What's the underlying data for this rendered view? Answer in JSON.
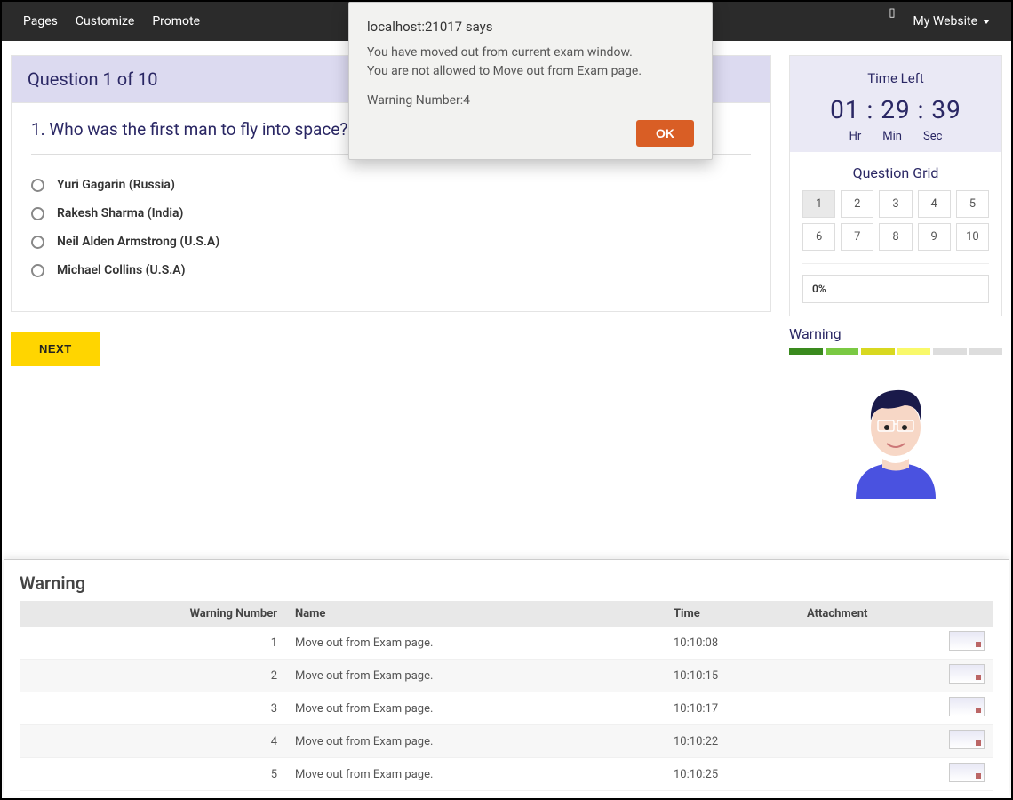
{
  "topbar": {
    "links": [
      "Pages",
      "Customize",
      "Promote"
    ],
    "site": "My Website"
  },
  "modal": {
    "title": "localhost:21017 says",
    "line1": "You have moved out from current exam window.",
    "line2": "You are not allowed to Move out from Exam page.",
    "warning": "Warning Number:4",
    "ok": "OK"
  },
  "question": {
    "header": "Question 1 of 10",
    "text": "1. Who was the first man to fly into space?",
    "options": [
      "Yuri Gagarin (Russia)",
      "Rakesh Sharma (India)",
      "Neil Alden Armstrong (U.S.A)",
      "Michael Collins (U.S.A)"
    ],
    "next": "NEXT"
  },
  "timer": {
    "title": "Time Left",
    "hr": "01",
    "min": "29",
    "sec": "39",
    "labels": {
      "hr": "Hr",
      "min": "Min",
      "sec": "Sec"
    }
  },
  "grid": {
    "title": "Question Grid",
    "cells": [
      "1",
      "2",
      "3",
      "4",
      "5",
      "6",
      "7",
      "8",
      "9",
      "10"
    ],
    "progress": "0%"
  },
  "warn": {
    "label": "Warning"
  },
  "table": {
    "heading": "Warning",
    "cols": {
      "num": "Warning Number",
      "name": "Name",
      "time": "Time",
      "att": "Attachment"
    },
    "rows": [
      {
        "n": "1",
        "name": "Move out from Exam page.",
        "time": "10:10:08"
      },
      {
        "n": "2",
        "name": "Move out from Exam page.",
        "time": "10:10:15"
      },
      {
        "n": "3",
        "name": "Move out from Exam page.",
        "time": "10:10:17"
      },
      {
        "n": "4",
        "name": "Move out from Exam page.",
        "time": "10:10:22"
      },
      {
        "n": "5",
        "name": "Move out from Exam page.",
        "time": "10:10:25"
      }
    ]
  }
}
